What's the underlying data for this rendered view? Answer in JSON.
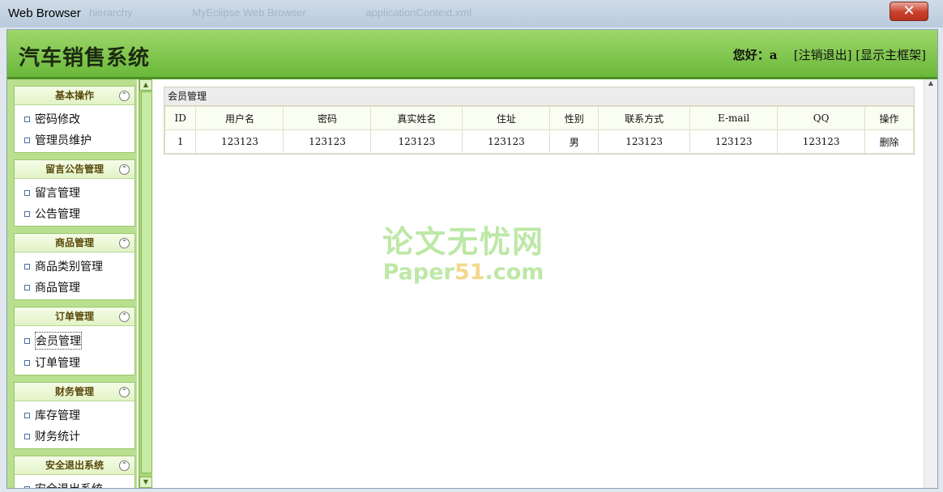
{
  "window": {
    "title": "Web Browser",
    "ghost_tabs": [
      "hierarchy",
      "MyEclipse Web Browser",
      "applicationContext.xml"
    ],
    "close": "✕"
  },
  "header": {
    "app_title": "汽车销售系统",
    "greeting": "您好：",
    "username": "a",
    "logout": "[注销退出]",
    "show_frame": "[显示主框架]"
  },
  "sidebar": {
    "sections": [
      {
        "title": "基本操作",
        "items": [
          "密码修改",
          "管理员维护"
        ]
      },
      {
        "title": "留言公告管理",
        "items": [
          "留言管理",
          "公告管理"
        ]
      },
      {
        "title": "商品管理",
        "items": [
          "商品类别管理",
          "商品管理"
        ]
      },
      {
        "title": "订单管理",
        "items": [
          "会员管理",
          "订单管理"
        ]
      },
      {
        "title": "财务管理",
        "items": [
          "库存管理",
          "财务统计"
        ]
      },
      {
        "title": "安全退出系统",
        "items": [
          "安全退出系统"
        ]
      }
    ]
  },
  "main": {
    "panel_title": "会员管理",
    "columns": [
      "ID",
      "用户名",
      "密码",
      "真实姓名",
      "住址",
      "性别",
      "联系方式",
      "E-mail",
      "QQ",
      "操作"
    ],
    "rows": [
      [
        "1",
        "123123",
        "123123",
        "123123",
        "123123",
        "男",
        "123123",
        "123123",
        "123123",
        "删除"
      ]
    ]
  },
  "watermark": {
    "line1": "论文无忧网",
    "line2_a": "Paper",
    "line2_b": "51",
    "line2_c": ".com"
  }
}
